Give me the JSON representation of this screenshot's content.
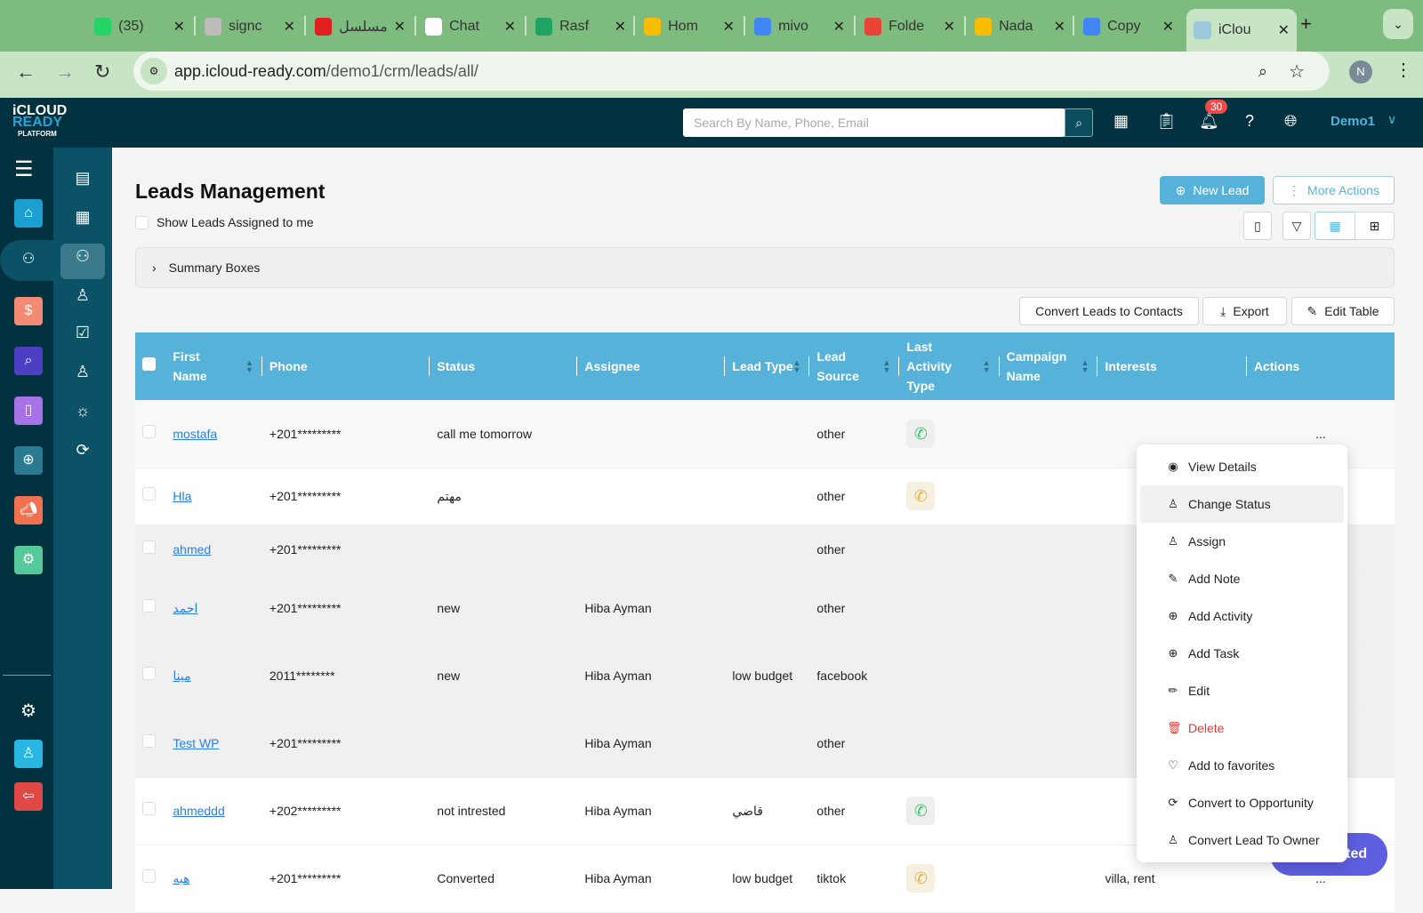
{
  "browser": {
    "tabs": [
      {
        "title": "(35)",
        "icon": "whatsapp-icon",
        "color": "#25d366"
      },
      {
        "title": "signc",
        "icon": "circle-icon",
        "color": "#bbbbbb"
      },
      {
        "title": "مسلسل",
        "icon": "youtube-icon",
        "color": "#e02020"
      },
      {
        "title": "Chat",
        "icon": "chatgpt-icon",
        "color": "#ffffff"
      },
      {
        "title": "Rasf",
        "icon": "sheets-icon",
        "color": "#1fa463"
      },
      {
        "title": "Hom",
        "icon": "drive-icon",
        "color": "#fbbc04"
      },
      {
        "title": "mivo",
        "icon": "calendar-icon",
        "color": "#4285f4"
      },
      {
        "title": "Folde",
        "icon": "gmail-icon",
        "color": "#ea4335"
      },
      {
        "title": "Nada",
        "icon": "drive-icon",
        "color": "#fbbc04"
      },
      {
        "title": "Copy",
        "icon": "docs-icon",
        "color": "#4285f4"
      },
      {
        "title": "iClou",
        "icon": "icloud-ready-icon",
        "color": "#9cc9dd",
        "active": true
      }
    ],
    "url_host": "app.icloud-ready.com",
    "url_path": "/demo1/crm/leads/all/",
    "profile": "N"
  },
  "header": {
    "logo": "iCLOUD READY PLATFORM",
    "search_placeholder": "Search By Name, Phone, Email",
    "notifications": "30",
    "user": "Demo1"
  },
  "page": {
    "title": "Leads Management",
    "show_assigned": "Show Leads Assigned to me",
    "new_lead": "New Lead",
    "more_actions": "More Actions",
    "summary": "Summary Boxes",
    "convert": "Convert Leads to Contacts",
    "export": "Export",
    "edit_table": "Edit Table"
  },
  "table": {
    "columns": [
      "First Name",
      "Phone",
      "Status",
      "Assignee",
      "Lead Type",
      "Lead Source",
      "Last Activity Type",
      "Campaign Name",
      "Interests",
      "Actions"
    ],
    "rows": [
      {
        "name": "mostafa",
        "phone": "+201*********",
        "status": "call me tomorrow",
        "assignee": "",
        "type": "",
        "source": "other",
        "activity": "whatsapp",
        "campaign": "",
        "interests": "",
        "actions": "..."
      },
      {
        "name": "Hla",
        "phone": "+201*********",
        "status": "مهتم",
        "assignee": "",
        "type": "",
        "source": "other",
        "activity": "call",
        "campaign": "",
        "interests": "",
        "actions": ""
      },
      {
        "name": "ahmed",
        "phone": "+201*********",
        "status": "",
        "assignee": "",
        "type": "",
        "source": "other",
        "activity": "",
        "campaign": "",
        "interests": "",
        "actions": ""
      },
      {
        "name": "احمد",
        "phone": "+201*********",
        "status": "new",
        "assignee": "Hiba Ayman",
        "type": "",
        "source": "other",
        "activity": "",
        "campaign": "",
        "interests": "",
        "actions": ""
      },
      {
        "name": "مينا",
        "phone": "2011********",
        "status": "new",
        "assignee": "Hiba Ayman",
        "type": "low budget",
        "source": "facebook",
        "activity": "",
        "campaign": "",
        "interests": "",
        "actions": ""
      },
      {
        "name": "Test WP",
        "phone": "+201*********",
        "status": "",
        "assignee": "Hiba Ayman",
        "type": "",
        "source": "other",
        "activity": "",
        "campaign": "",
        "interests": "",
        "actions": ""
      },
      {
        "name": "ahmeddd",
        "phone": "+202*********",
        "status": "not intrested",
        "assignee": "Hiba Ayman",
        "type": "قاضي",
        "source": "other",
        "activity": "whatsapp",
        "campaign": "",
        "interests": "",
        "actions": ""
      },
      {
        "name": "هبه",
        "phone": "+201*********",
        "status": "Converted",
        "assignee": "Hiba Ayman",
        "type": "low budget",
        "source": "tiktok",
        "activity": "call",
        "campaign": "",
        "interests": "villa, rent",
        "actions": "..."
      }
    ]
  },
  "menu": [
    {
      "label": "View Details",
      "icon": "eye-icon",
      "glyph": "◉"
    },
    {
      "label": "Change Status",
      "icon": "user-icon",
      "glyph": "♙",
      "hl": true
    },
    {
      "label": "Assign",
      "icon": "user-icon",
      "glyph": "♙"
    },
    {
      "label": "Add Note",
      "icon": "note-edit-icon",
      "glyph": "✎"
    },
    {
      "label": "Add Activity",
      "icon": "plus-circle-icon",
      "glyph": "⊕"
    },
    {
      "label": "Add Task",
      "icon": "plus-circle-icon",
      "glyph": "⊕"
    },
    {
      "label": "Edit",
      "icon": "pencil-icon",
      "glyph": "✏"
    },
    {
      "label": "Delete",
      "icon": "trash-icon",
      "glyph": "🗑",
      "color": "#e53935"
    },
    {
      "label": "Add to favorites",
      "icon": "heart-icon",
      "glyph": "♡"
    },
    {
      "label": "Convert to Opportunity",
      "icon": "convert-icon",
      "glyph": "⟳"
    },
    {
      "label": "Convert Lead To Owner",
      "icon": "owner-icon",
      "glyph": "♙"
    }
  ],
  "get_started": "Get Started",
  "colors": {
    "header": "#02313f",
    "sidebar": "#0b5266",
    "table_header": "#57b2d9",
    "primary": "#57b2d9",
    "link": "#2a7ee8"
  }
}
